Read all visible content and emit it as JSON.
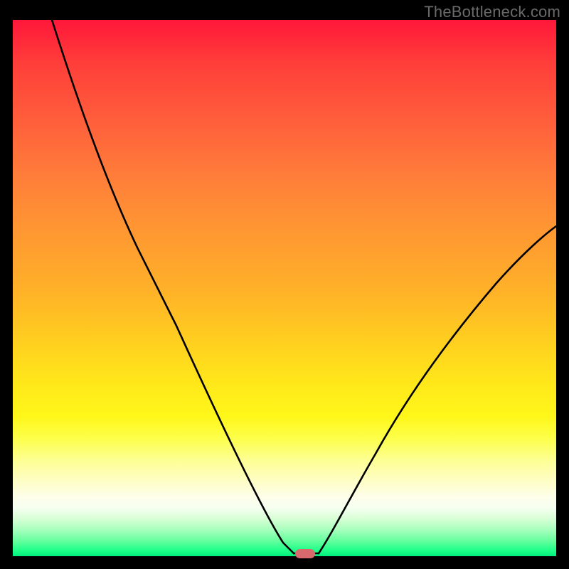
{
  "watermark": "TheBottleneck.com",
  "colors": {
    "background": "#000000",
    "gradient_top": "#ff173a",
    "gradient_bottom": "#00ee7c",
    "curve": "#000000",
    "marker": "#d86a6d"
  },
  "chart_data": {
    "type": "line",
    "title": "",
    "xlabel": "",
    "ylabel": "",
    "xlim": [
      0,
      100
    ],
    "ylim": [
      0,
      100
    ],
    "x": [
      0,
      3,
      8,
      14,
      20,
      25,
      28,
      32,
      36,
      40,
      44,
      48,
      50,
      52,
      54,
      56,
      58,
      62,
      68,
      74,
      80,
      86,
      92,
      98,
      100
    ],
    "y": [
      100,
      96,
      87,
      77,
      67,
      57,
      47,
      36,
      26,
      17,
      10,
      4,
      1,
      0,
      0,
      1,
      4,
      10,
      20,
      30,
      39,
      47,
      54,
      60,
      62
    ],
    "marker": {
      "x": 53,
      "y": 0
    },
    "notes": "V-shaped bottleneck curve over a vertical red-to-green gradient. Y values are percentages (high = red/bad, low = green/good). Axis labels and ticks are not shown in the source image."
  }
}
